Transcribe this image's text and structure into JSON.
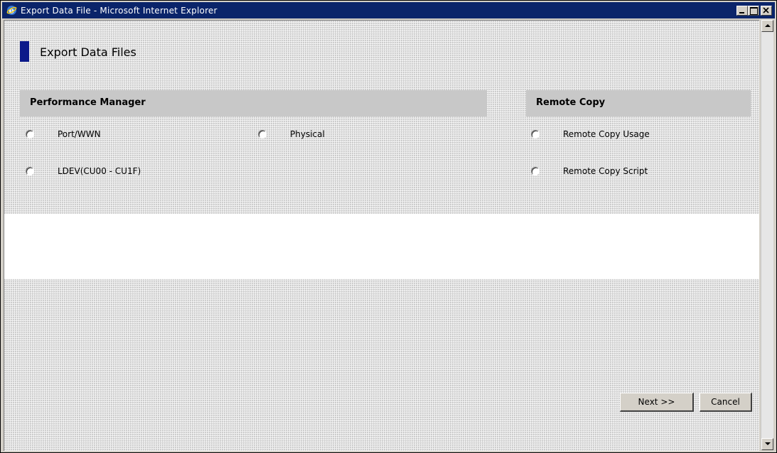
{
  "window": {
    "title": "Export Data File - Microsoft Internet Explorer"
  },
  "page": {
    "title": "Export Data Files"
  },
  "sections": {
    "performance_manager": {
      "label": "Performance Manager",
      "options": [
        "Port/WWN",
        "Physical",
        "LDEV(CU00 - CU1F)"
      ]
    },
    "remote_copy": {
      "label": "Remote Copy",
      "options": [
        "Remote Copy Usage",
        "Remote Copy Script"
      ]
    }
  },
  "buttons": {
    "next": "Next >>",
    "cancel": "Cancel"
  },
  "colors": {
    "titlebar": "#0a246a",
    "title_marker": "#0c1a8a",
    "section_header": "#c8c8c8"
  }
}
